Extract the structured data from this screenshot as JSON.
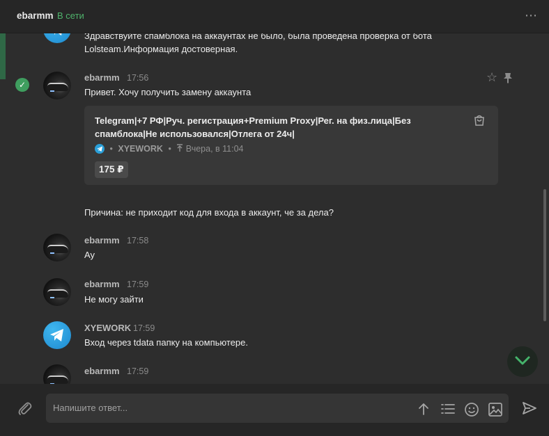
{
  "header": {
    "title": "ebarmm",
    "status": "В сети",
    "more_icon": "⋯"
  },
  "messages": {
    "m0": {
      "line1": "Здравствуйте спамблока на аккаунтах не было, была проведена проверка от бота",
      "line2": "Lolsteam.Информация достоверная."
    },
    "m1": {
      "name": "ebarmm",
      "time": "17:56",
      "text": "Привет. Хочу получить замену аккаунта",
      "reason": "Причина: не приходит код для входа в аккаунт, че за дела?"
    },
    "card": {
      "title_line1": "Telegram|+7 РФ|Руч. регистрация+Premium Proxy|Рег. на физ.лица|Без",
      "title_line2": "спамблока|Не использовался|Отлега от 24ч|",
      "seller": "XYEWORK",
      "bullet": "•",
      "date": "Вчера, в 11:04",
      "price": "175 ₽"
    },
    "m2": {
      "name": "ebarmm",
      "time": "17:58",
      "text": "Ау"
    },
    "m3": {
      "name": "ebarmm",
      "time": "17:59",
      "text": "Не могу зайти"
    },
    "m4": {
      "name": "XYEWORK",
      "time": "17:59",
      "text": "Вход через tdata папку на компьютере."
    },
    "m5": {
      "name": "ebarmm",
      "time": "17:59"
    }
  },
  "composer": {
    "placeholder": "Напишите ответ..."
  },
  "colors": {
    "accent": "#4fb36c",
    "telegram": "#2a9fd8"
  }
}
